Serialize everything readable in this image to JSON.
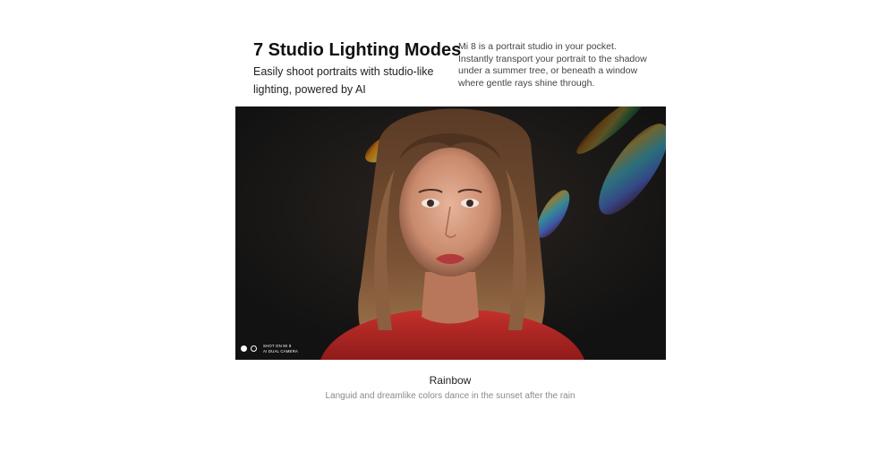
{
  "header": {
    "title": "7 Studio Lighting Modes",
    "subtitle": "Easily shoot portraits with studio-like lighting, powered by AI",
    "description": "Mi 8 is a portrait studio in your pocket. Instantly transport your portrait to the shadow under a summer tree, or beneath a window where gentle rays shine through."
  },
  "photo": {
    "watermark_line1": "SHOT ON MI 8",
    "watermark_line2": "AI DUAL CAMERA"
  },
  "caption": {
    "mode_name": "Rainbow",
    "mode_description": "Languid and dreamlike colors dance in the sunset after the rain"
  }
}
